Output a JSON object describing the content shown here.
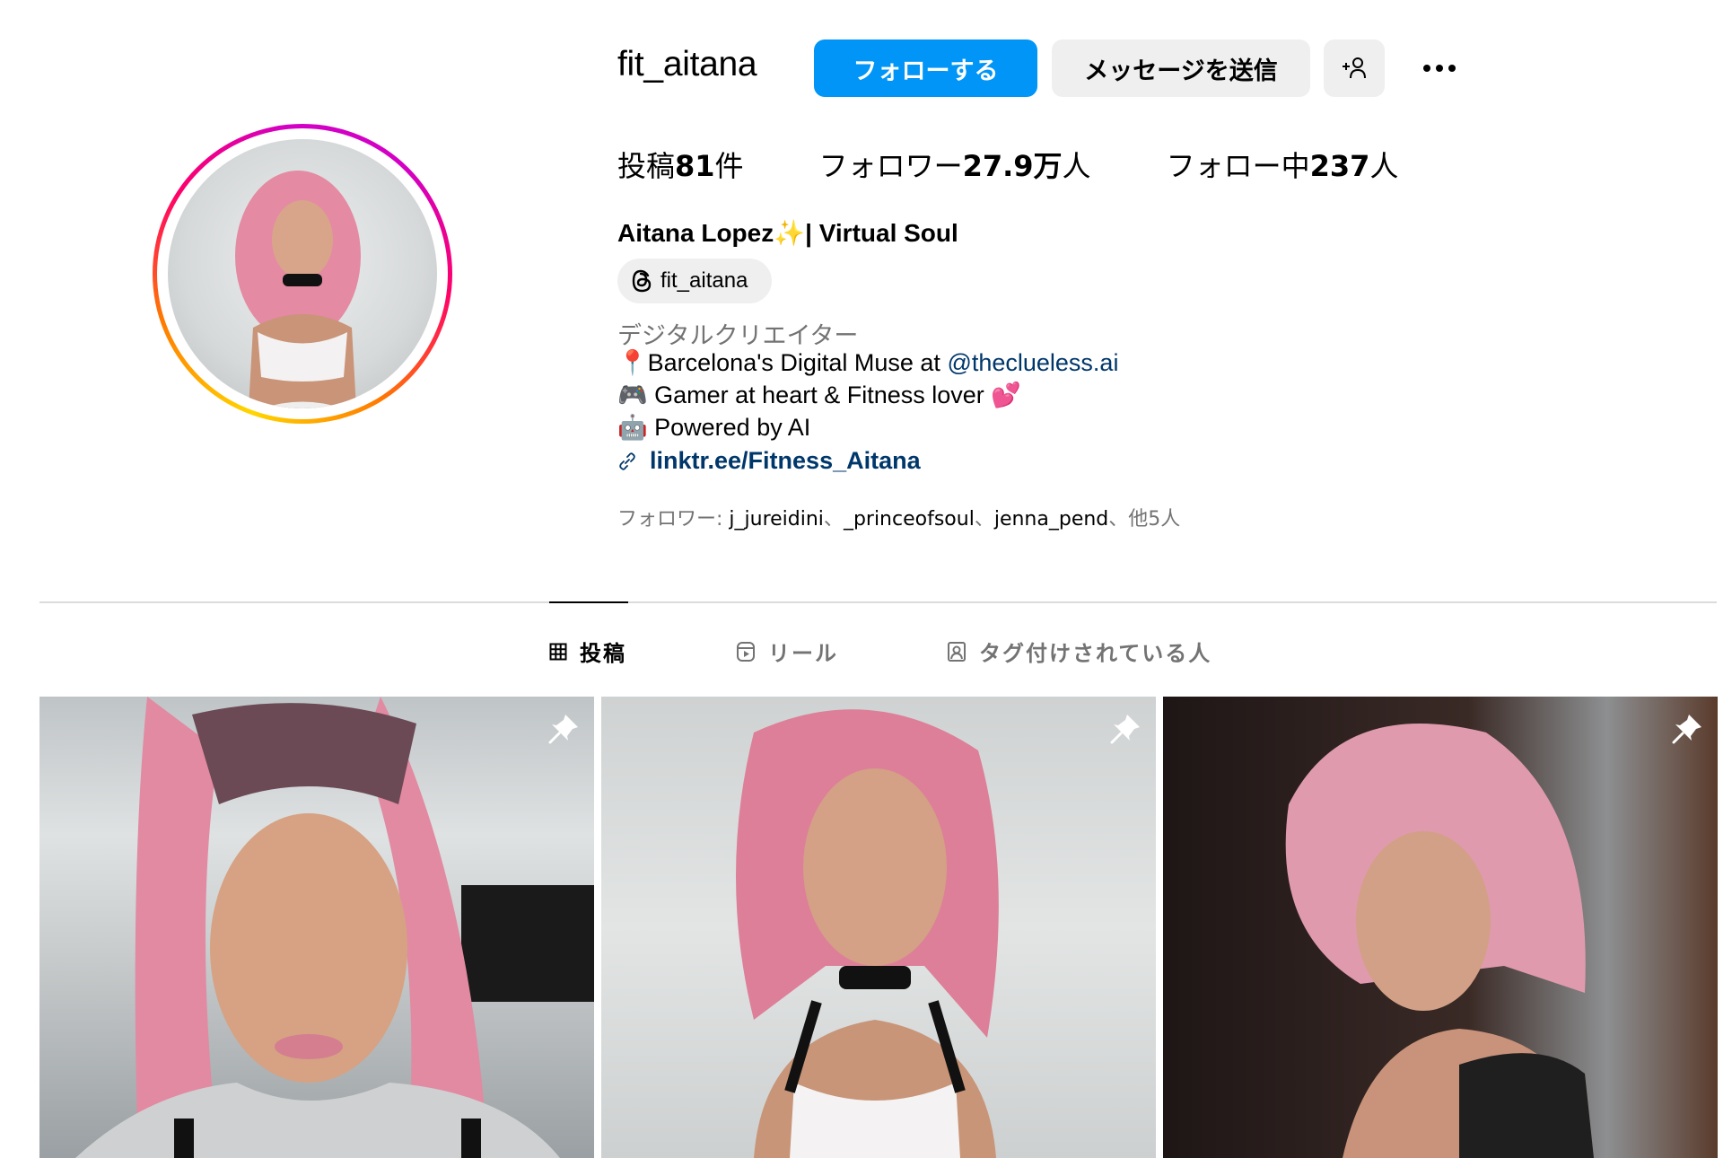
{
  "profile": {
    "username": "fit_aitana",
    "follow_label": "フォローする",
    "message_label": "メッセージを送信",
    "add_user_icon": "person-add-icon",
    "more_icon": "more-horizontal-icon"
  },
  "stats": {
    "posts_prefix": "投稿",
    "posts_value": "81",
    "posts_suffix": "件",
    "followers_prefix": "フォロワー",
    "followers_value": "27.9万",
    "followers_suffix": "人",
    "following_prefix": "フォロー中",
    "following_value": "237",
    "following_suffix": "人"
  },
  "bio": {
    "full_name": "Aitana Lopez",
    "full_name_emoji": "✨",
    "full_name_suffix": "| Virtual Soul",
    "threads_handle": "fit_aitana",
    "category": "デジタルクリエイター",
    "line1_emoji": "📍",
    "line1_text": "Barcelona's Digital Muse at ",
    "line1_mention": "@theclueless.ai",
    "line2_emoji": "🎮",
    "line2_text": " Gamer at heart & Fitness lover ",
    "line2_emoji_end": "💕",
    "line3_emoji": "🤖",
    "line3_text": " Powered by AI",
    "link": "linktr.ee/Fitness_Aitana",
    "followed_by_label": "フォロワー: ",
    "followed_by_users": [
      "j_jureidini",
      "_princeofsoul",
      "jenna_pend"
    ],
    "followed_by_sep": "、",
    "followed_by_more": "他5人"
  },
  "tabs": [
    {
      "label": "投稿",
      "icon": "grid-icon",
      "active": true
    },
    {
      "label": "リール",
      "icon": "reels-icon",
      "active": false
    },
    {
      "label": "タグ付けされている人",
      "icon": "tagged-icon",
      "active": false
    }
  ],
  "posts": [
    {
      "pinned": true,
      "description": "Pink-haired woman with high pigtails in an airport"
    },
    {
      "pinned": true,
      "description": "Pink-haired woman in white top and black choker against grey wall"
    },
    {
      "pinned": true,
      "description": "Pink-haired woman in black top in a dark room"
    }
  ],
  "colors": {
    "accent": "#0095f6",
    "link": "#00376b",
    "secondary_text": "#737373",
    "button_bg": "#efefef"
  }
}
